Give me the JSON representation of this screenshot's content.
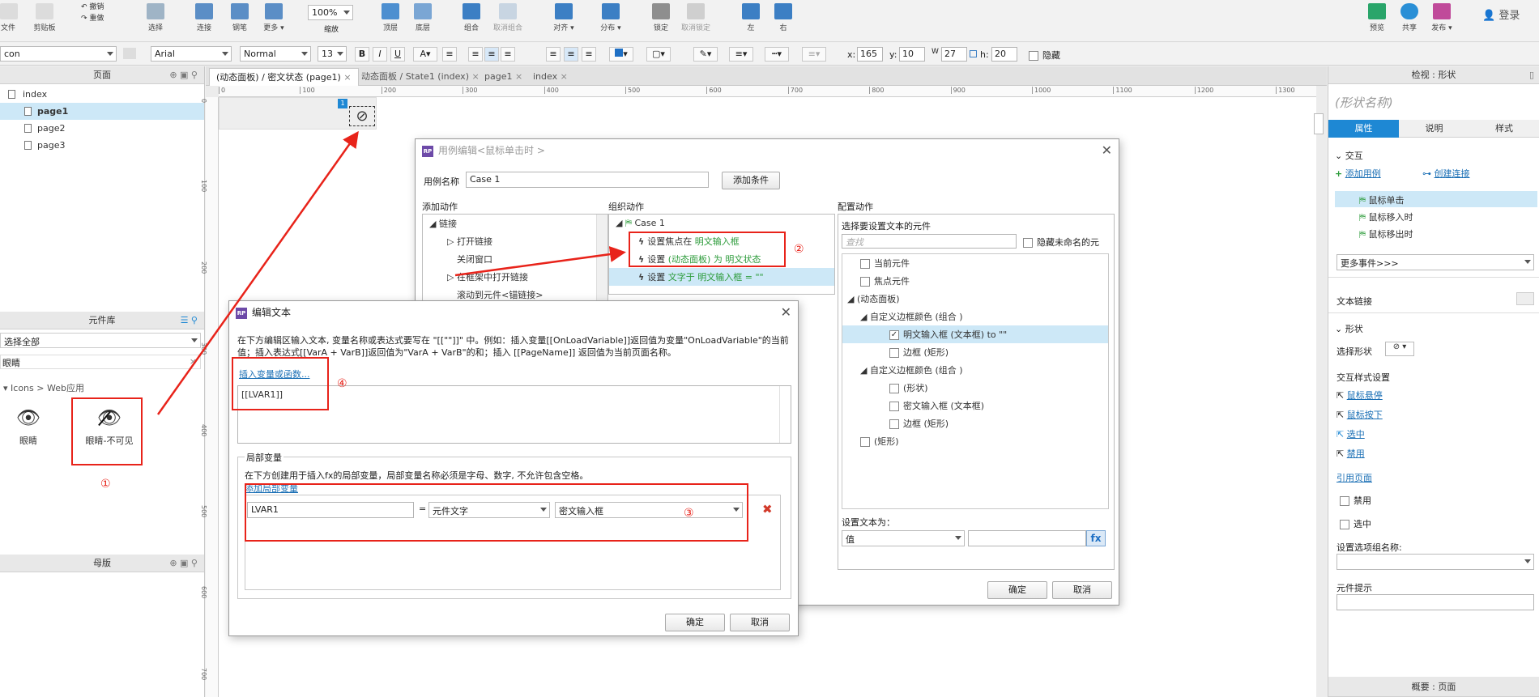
{
  "toolbar": {
    "left_labels": [
      "文件",
      "剪贴板"
    ],
    "edit_small": [
      "撤销",
      "重做"
    ],
    "items": [
      {
        "label": "选择",
        "icon": "select-icon"
      },
      {
        "label": "连接",
        "icon": "connect-icon"
      },
      {
        "label": "钢笔",
        "icon": "pen-icon"
      },
      {
        "label": "更多 ▾",
        "icon": "more-icon"
      }
    ],
    "zoom_value": "100%",
    "zoom_label": "缩放",
    "arrange": [
      {
        "label": "顶层"
      },
      {
        "label": "底层"
      },
      {
        "label": "组合"
      },
      {
        "label": "取消组合"
      },
      {
        "label": "对齐 ▾"
      },
      {
        "label": "分布 ▾"
      },
      {
        "label": "锁定"
      },
      {
        "label": "取消锁定"
      },
      {
        "label": "左"
      },
      {
        "label": "右"
      }
    ],
    "right": [
      {
        "label": "预览",
        "icon": "preview-icon"
      },
      {
        "label": "共享",
        "icon": "share-icon"
      },
      {
        "label": "发布 ▾",
        "icon": "publish-icon"
      }
    ],
    "login": "登录"
  },
  "format_bar": {
    "style_select": "con",
    "font": "Arial",
    "weight": "Normal",
    "size": "13",
    "x_label": "x:",
    "x": "165",
    "y_label": "y:",
    "y": "10",
    "w_label": "W",
    "w": "27",
    "h_label": "h:",
    "h": "20",
    "hidden": "隐藏"
  },
  "pages_panel": {
    "title": "页面",
    "pages": [
      "index",
      "page1",
      "page2",
      "page3"
    ],
    "selected": "page1"
  },
  "widgets_panel": {
    "title": "元件库",
    "library": "选择全部",
    "search": "眼睛",
    "breadcrumb": "Icons > Web应用",
    "items": [
      "眼睛",
      "眼睛-不可见"
    ]
  },
  "masters_panel": {
    "title": "母版"
  },
  "tabs": [
    {
      "label": "(动态面板) / 密文状态 (page1)"
    },
    {
      "label": "动态面板 / State1 (index)"
    },
    {
      "label": "page1"
    },
    {
      "label": "index"
    }
  ],
  "ruler_h": [
    "0",
    "100",
    "200",
    "300",
    "400",
    "500",
    "600",
    "700",
    "800",
    "900",
    "1000",
    "1100",
    "1200",
    "1300"
  ],
  "ruler_v": [
    "0",
    "100",
    "200",
    "300",
    "400",
    "500",
    "600",
    "700"
  ],
  "case_dialog": {
    "title": "用例编辑<鼠标单击时 >",
    "case_name_label": "用例名称",
    "case_name": "Case 1",
    "add_condition": "添加条件",
    "add_action_title": "添加动作",
    "organize_title": "组织动作",
    "configure_title": "配置动作",
    "actions": [
      "链接",
      "打开链接",
      "关闭窗口",
      "在框架中打开链接",
      "滚动到元件<锚链接>"
    ],
    "case_label": "Case 1",
    "steps": [
      {
        "prefix": "设置焦点在 ",
        "target": "明文输入框"
      },
      {
        "prefix": "设置 ",
        "target": "(动态面板) 为 明文状态"
      },
      {
        "prefix": "设置 ",
        "target": "文字于 明文输入框 = \"\""
      }
    ],
    "select_widgets_title": "选择要设置文本的元件",
    "search_placeholder": "查找",
    "hide_unnamed": "隐藏未命名的元",
    "widget_tree": [
      "当前元件",
      "焦点元件",
      "(动态面板)",
      "自定义边框颜色 (组合 )",
      "明文输入框 (文本框) to \"\"",
      "边框 (矩形)",
      "自定义边框颜色 (组合 )",
      "(形状)",
      "密文输入框 (文本框)",
      "边框 (矩形)",
      "(矩形)"
    ],
    "set_text_label": "设置文本为：",
    "set_text_type": "值",
    "fx": "fx",
    "ok": "确定",
    "cancel": "取消"
  },
  "edit_text_dialog": {
    "title": "编辑文本",
    "description": "在下方编辑区输入文本, 变量名称或表达式要写在 \"[[\"\"]]\" 中。例如：插入变量[[OnLoadVariable]]返回值为变量\"OnLoadVariable\"的当前值；插入表达式[[VarA + VarB]]返回值为\"VarA + VarB\"的和；插入 [[PageName]] 返回值为当前页面名称。",
    "insert_link": "插入变量或函数...",
    "text": "[[LVAR1]]",
    "local_vars_title": "局部变量",
    "local_vars_desc": "在下方创建用于插入fx的局部变量，局部变量名称必须是字母、数字, 不允许包含空格。",
    "add_local": "添加局部变量",
    "var_name": "LVAR1",
    "equals": "=",
    "var_type": "元件文字",
    "var_target": "密文输入框",
    "ok": "确定",
    "cancel": "取消"
  },
  "inspector": {
    "title": "检视 : 形状",
    "shape_name": "(形状名称)",
    "tabs": [
      "属性",
      "说明",
      "样式"
    ],
    "interaction": "交互",
    "add_case": "添加用例",
    "create_link": "创建连接",
    "events": [
      "鼠标单击",
      "鼠标移入时",
      "鼠标移出时"
    ],
    "more_events": "更多事件>>>",
    "text_link": "文本链接",
    "shape_section": "形状",
    "select_shape": "选择形状",
    "interaction_styles": "交互样式设置",
    "style_links": [
      "鼠标悬停",
      "鼠标按下",
      "选中",
      "禁用"
    ],
    "ref_page": "引用页面",
    "disabled": "禁用",
    "selected": "选中",
    "group_name": "设置选项组名称:",
    "tooltip": "元件提示",
    "overview": "概要 : 页面"
  },
  "annotations": [
    "①",
    "②",
    "③",
    "④"
  ],
  "colors": {
    "accent": "#1e88d4",
    "annotation": "#e8231a",
    "selection": "#cde8f7"
  }
}
